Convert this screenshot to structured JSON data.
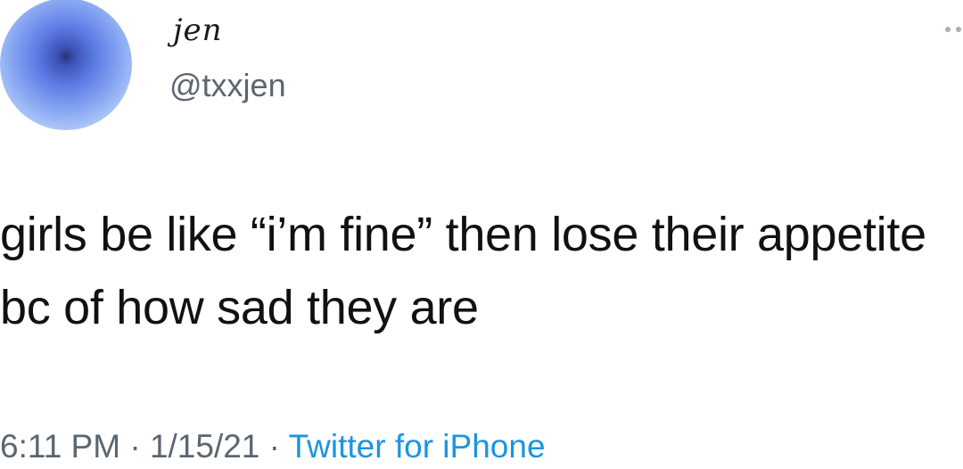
{
  "tweet": {
    "author": {
      "display_name": "jen",
      "handle": "@txxjen",
      "avatar_icon": "profile-avatar"
    },
    "text": "girls be like “i’m fine” then lose their appetite bc of how sad they are",
    "time": "6:11 PM",
    "separator": " · ",
    "date": "1/15/21",
    "source": "Twitter for iPhone",
    "more_icon": "more-options-icon"
  },
  "colors": {
    "text": "#111111",
    "secondary": "#5b6670",
    "link": "#1b95e0"
  }
}
